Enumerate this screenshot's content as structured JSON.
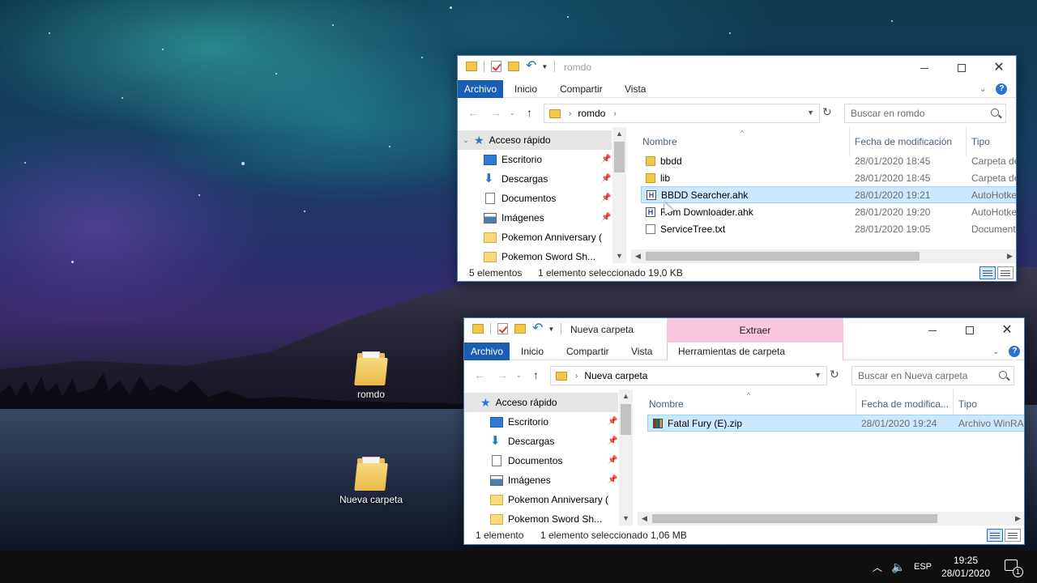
{
  "desktop": {
    "icons": [
      {
        "label": "romdo"
      },
      {
        "label": "Nueva carpeta"
      }
    ]
  },
  "window_top": {
    "title": "romdo",
    "tabs": [
      "Archivo",
      "Inicio",
      "Compartir",
      "Vista"
    ],
    "address": {
      "segment": "romdo"
    },
    "search_placeholder": "Buscar en romdo",
    "nav": {
      "quick_access": "Acceso rápido",
      "items": [
        "Escritorio",
        "Descargas",
        "Documentos",
        "Imágenes",
        "Pokemon Anniversary (",
        "Pokemon Sword Sh..."
      ]
    },
    "columns": {
      "name": "Nombre",
      "date": "Fecha de modificación",
      "type": "Tipo"
    },
    "files": [
      {
        "name": "bbdd",
        "date": "28/01/2020 18:45",
        "type": "Carpeta de",
        "icon": "folder-icon"
      },
      {
        "name": "lib",
        "date": "28/01/2020 18:45",
        "type": "Carpeta de",
        "icon": "folder-icon"
      },
      {
        "name": "BBDD Searcher.ahk",
        "date": "28/01/2020 19:21",
        "type": "AutoHotke",
        "icon": "ahk-file-icon",
        "selected": true
      },
      {
        "name": "Rom Downloader.ahk",
        "date": "28/01/2020 19:20",
        "type": "AutoHotke",
        "icon": "ahk-file-icon"
      },
      {
        "name": "ServiceTree.txt",
        "date": "28/01/2020 19:05",
        "type": "Document",
        "icon": "text-file-icon"
      }
    ],
    "status": {
      "count": "5 elementos",
      "selection": "1 elemento seleccionado 19,0 KB"
    }
  },
  "window_bottom": {
    "title": "Nueva carpeta",
    "context_header": "Extraer",
    "tabs": [
      "Archivo",
      "Inicio",
      "Compartir",
      "Vista",
      "Herramientas de carpeta comprimida"
    ],
    "address": {
      "segment": "Nueva carpeta"
    },
    "search_placeholder": "Buscar en Nueva carpeta",
    "nav": {
      "quick_access": "Acceso rápido",
      "items": [
        "Escritorio",
        "Descargas",
        "Documentos",
        "Imágenes",
        "Pokemon Anniversary (",
        "Pokemon Sword Sh..."
      ]
    },
    "columns": {
      "name": "Nombre",
      "date": "Fecha de modifica...",
      "type": "Tipo"
    },
    "files": [
      {
        "name": "Fatal Fury (E).zip",
        "date": "28/01/2020 19:24",
        "type": "Archivo WinRA",
        "icon": "zip-archive-icon",
        "selected": true
      }
    ],
    "status": {
      "count": "1 elemento",
      "selection": "1 elemento seleccionado 1,06 MB"
    }
  },
  "taskbar": {
    "language": "ESP",
    "time": "19:25",
    "date": "28/01/2020",
    "notification_count": "1"
  }
}
